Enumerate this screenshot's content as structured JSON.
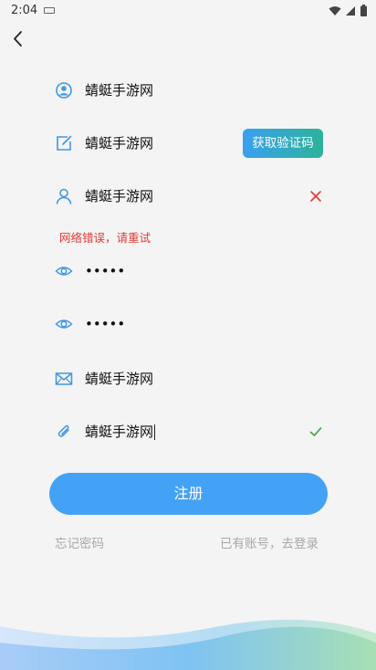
{
  "status_bar": {
    "time": "2:04",
    "icons": [
      "wifi-icon",
      "signal-icon",
      "battery-icon"
    ]
  },
  "nav": {
    "back_icon": "chevron-left-icon"
  },
  "form": {
    "fields": [
      {
        "icon": "user-circle-icon",
        "value": "蜻蜓手游网"
      },
      {
        "icon": "edit-icon",
        "value": "蜻蜓手游网"
      },
      {
        "icon": "person-icon",
        "value": "蜻蜓手游网",
        "trailing": "clear-icon"
      },
      {
        "icon": "eye-icon",
        "value": "•••••"
      },
      {
        "icon": "eye-icon",
        "value": "•••••"
      },
      {
        "icon": "mail-icon",
        "value": "蜻蜓手游网"
      },
      {
        "icon": "paperclip-icon",
        "value": "蜻蜓手游网",
        "trailing": "check-icon"
      }
    ],
    "code_button_label": "获取验证码",
    "error_message": "网络错误，请重试"
  },
  "actions": {
    "register_label": "注册",
    "forgot_password": "忘记密码",
    "have_account": "已有账号，去登录"
  },
  "colors": {
    "accent": "#44a2f6",
    "error": "#e53935",
    "success": "#43a047",
    "icon": "#3f96e8"
  }
}
